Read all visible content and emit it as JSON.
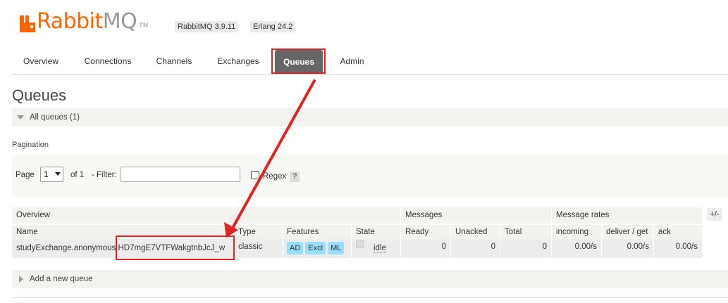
{
  "header": {
    "logo": {
      "rabbit": "Rabbit",
      "mq": "MQ",
      "tm": "TM"
    },
    "rabbitmq_version": "RabbitMQ 3.9.11",
    "erlang_version": "Erlang 24.2"
  },
  "tabs": [
    {
      "label": "Overview"
    },
    {
      "label": "Connections"
    },
    {
      "label": "Channels"
    },
    {
      "label": "Exchanges"
    },
    {
      "label": "Queues",
      "active": true
    },
    {
      "label": "Admin"
    }
  ],
  "page_title": "Queues",
  "all_queues_label": "All queues (1)",
  "pagination": {
    "label": "Pagination",
    "page_label": "Page",
    "page_value": "1",
    "of_label": "of 1",
    "filter_label": "- Filter:",
    "filter_value": "",
    "regex_label": "Regex",
    "help_label": "?"
  },
  "table": {
    "groups": {
      "overview": "Overview",
      "messages": "Messages",
      "rates": "Message rates"
    },
    "columns": [
      "Name",
      "Type",
      "Features",
      "State",
      "Ready",
      "Unacked",
      "Total",
      "incoming",
      "deliver / get",
      "ack"
    ],
    "toggle_label": "+/-",
    "rows": [
      {
        "name": "studyExchange.anonymous.HD7mgE7VTFWakgtnbJcJ_w",
        "type": "classic",
        "features": [
          "AD",
          "Excl",
          "ML"
        ],
        "state": "idle",
        "ready": "0",
        "unacked": "0",
        "total": "0",
        "incoming": "0.00/s",
        "deliver_get": "0.00/s",
        "ack": "0.00/s"
      }
    ]
  },
  "add_queue_label": "Add a new queue",
  "colors": {
    "brand": "#ff6600",
    "active_tab": "#666666",
    "annotation": "#e32323",
    "feature_tag": "#99ddff"
  }
}
